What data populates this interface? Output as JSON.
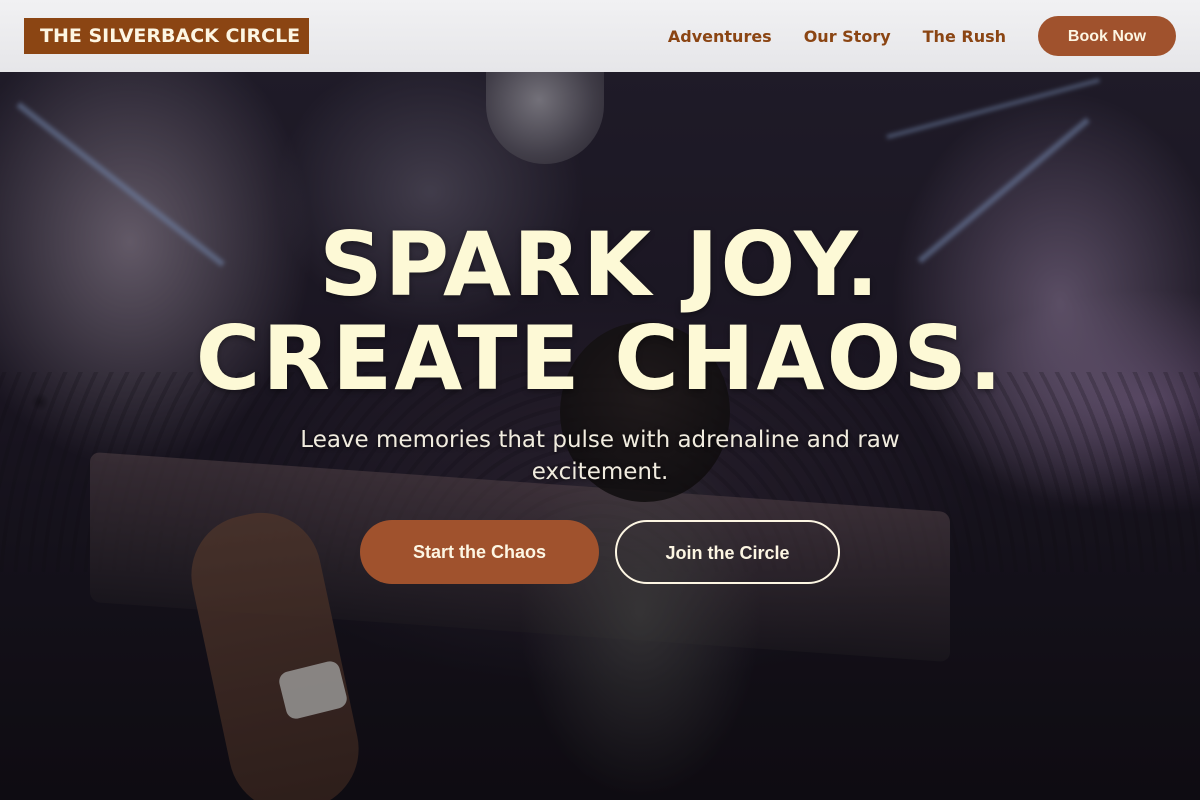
{
  "header": {
    "logo_text": "THE SILVERBACK CIRCLE",
    "nav": [
      {
        "label": "Adventures"
      },
      {
        "label": "Our Story"
      },
      {
        "label": "The Rush"
      }
    ],
    "book_button": "Book Now"
  },
  "hero": {
    "headline_line1": "SPARK JOY.",
    "headline_line2": "CREATE CHAOS.",
    "subtitle": "Leave memories that pulse with adrenaline and raw excitement.",
    "primary_cta": "Start the Chaos",
    "secondary_cta": "Join the Circle",
    "background_image": "club-dj-crowd-photo"
  },
  "colors": {
    "brand_brown": "#8b4513",
    "button_brown": "#a0522d",
    "header_bg": "#eeeef0",
    "headline_cream": "#fdf9d6",
    "light_text": "#fdf6e3"
  }
}
